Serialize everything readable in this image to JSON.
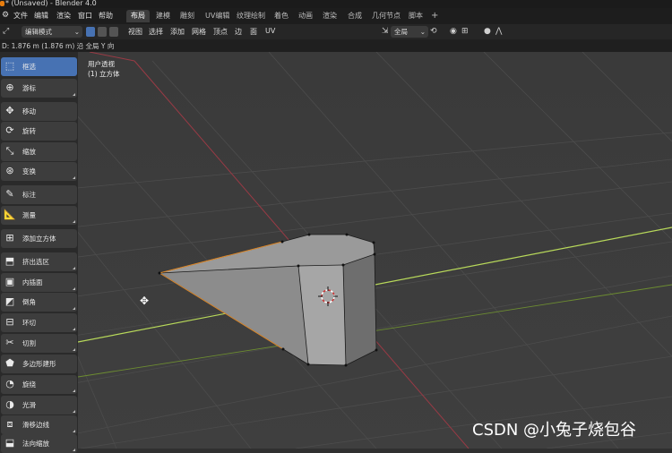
{
  "title_bar": {
    "title": "* (Unsaved) - Blender 4.0"
  },
  "menu": {
    "items": [
      "文件",
      "编辑",
      "渲染",
      "窗口",
      "帮助"
    ],
    "workspaces": [
      "布局",
      "建模",
      "雕刻",
      "UV编辑",
      "纹理绘制",
      "着色",
      "动画",
      "渲染",
      "合成",
      "几何节点",
      "脚本"
    ],
    "active_workspace": "布局",
    "add_tab": "+"
  },
  "header": {
    "mode": "编辑模式",
    "menus": [
      "视图",
      "选择",
      "添加",
      "网格",
      "顶点",
      "边",
      "面",
      "UV"
    ],
    "transform_orientation": "全局"
  },
  "status": {
    "text": "D: 1.876 m (1.876 m) 沿 全局 Y 向"
  },
  "viewport": {
    "view_name": "用户透视",
    "object_name": "(1) 立方体"
  },
  "toolbar": {
    "tools": [
      {
        "label": "框选",
        "icon": "box-select-icon",
        "active": true
      },
      {
        "label": "游标",
        "icon": "cursor-icon"
      },
      {
        "label": "移动",
        "icon": "move-icon"
      },
      {
        "label": "旋转",
        "icon": "rotate-icon"
      },
      {
        "label": "缩放",
        "icon": "scale-icon"
      },
      {
        "label": "变换",
        "icon": "transform-icon"
      },
      {
        "label": "标注",
        "icon": "annotate-icon"
      },
      {
        "label": "测量",
        "icon": "measure-icon"
      },
      {
        "label": "添加立方体",
        "icon": "add-cube-icon"
      },
      {
        "label": "挤出选区",
        "icon": "extrude-icon"
      },
      {
        "label": "内插面",
        "icon": "inset-icon"
      },
      {
        "label": "倒角",
        "icon": "bevel-icon"
      },
      {
        "label": "环切",
        "icon": "loop-cut-icon"
      },
      {
        "label": "切割",
        "icon": "knife-icon"
      },
      {
        "label": "多边形建形",
        "icon": "poly-build-icon"
      },
      {
        "label": "旋绕",
        "icon": "spin-icon"
      },
      {
        "label": "光滑",
        "icon": "smooth-icon"
      },
      {
        "label": "滑移边线",
        "icon": "edge-slide-icon"
      },
      {
        "label": "法向缩放",
        "icon": "shrink-icon"
      }
    ]
  },
  "watermark": "CSDN @小兔子烧包谷",
  "colors": {
    "active_tool": "#4772b3",
    "x_axis": "#b8404a",
    "y_axis": "#8fbf3c"
  }
}
